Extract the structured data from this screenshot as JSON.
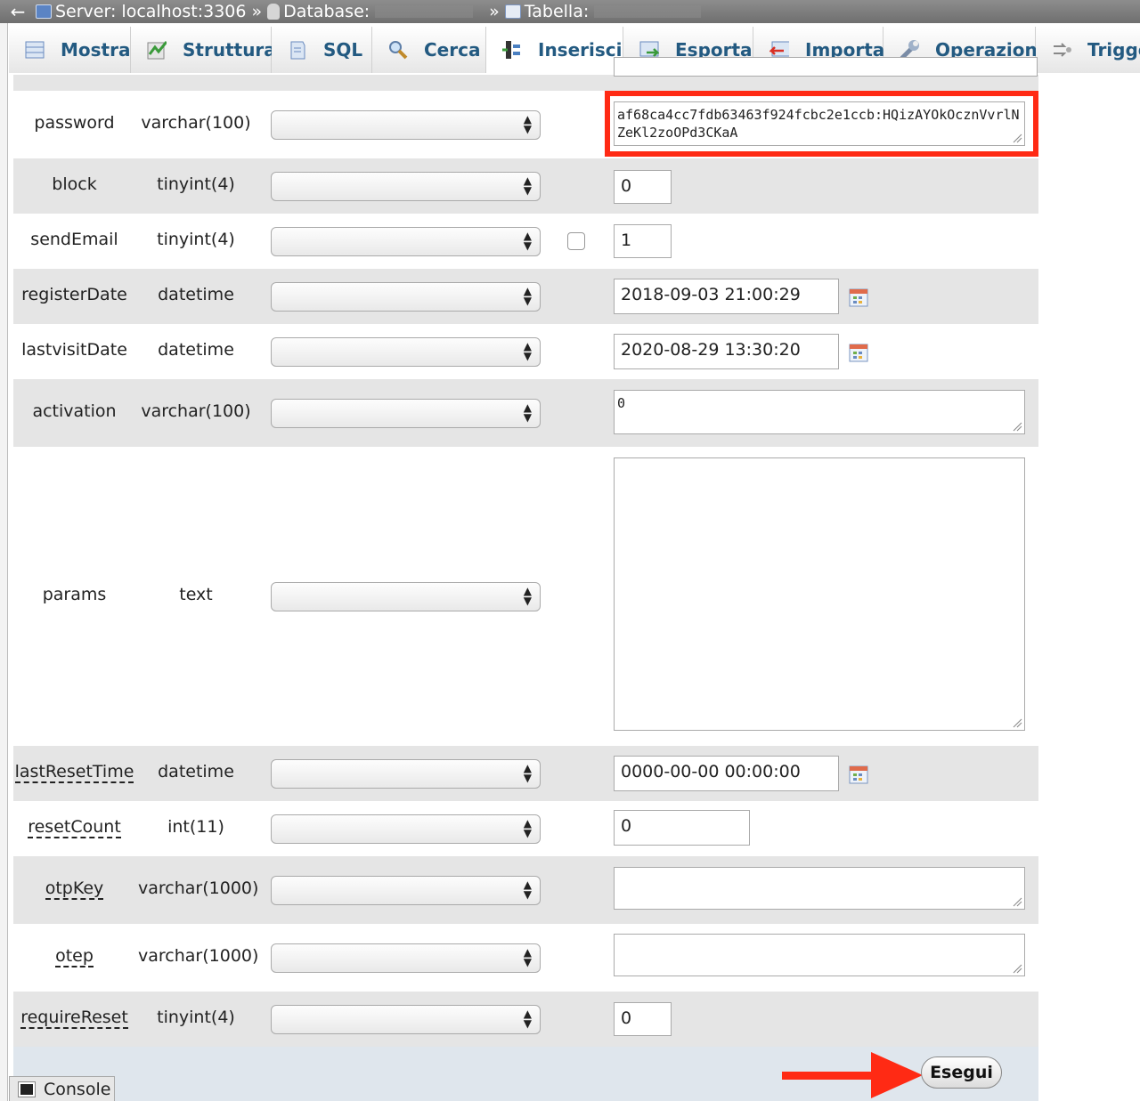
{
  "breadcrumb": {
    "back": "←",
    "server": "Server: localhost:3306",
    "database": "Database:",
    "table": "Tabella:",
    "separator": "»"
  },
  "tabs": [
    {
      "label": "Mostra",
      "icon": "browse-icon"
    },
    {
      "label": "Struttura",
      "icon": "structure-icon"
    },
    {
      "label": "SQL",
      "icon": "sql-icon"
    },
    {
      "label": "Cerca",
      "icon": "search-icon"
    },
    {
      "label": "Inserisci",
      "icon": "insert-icon",
      "active": true
    },
    {
      "label": "Esporta",
      "icon": "export-icon"
    },
    {
      "label": "Importa",
      "icon": "import-icon"
    },
    {
      "label": "Operazioni",
      "icon": "wrench-icon"
    },
    {
      "label": "Trigge",
      "icon": "triggers-icon"
    }
  ],
  "fields": [
    {
      "name": "password",
      "type": "varchar(100)",
      "value": "af68ca4cc7fdb63463f924fcbc2e1ccb:HQizAYOkOcznVvrlNZeKl2zoOPd3CKaA",
      "highlighted": true
    },
    {
      "name": "block",
      "type": "tinyint(4)",
      "value": "0"
    },
    {
      "name": "sendEmail",
      "type": "tinyint(4)",
      "value": "1",
      "null_checkbox": true
    },
    {
      "name": "registerDate",
      "type": "datetime",
      "value": "2018-09-03 21:00:29"
    },
    {
      "name": "lastvisitDate",
      "type": "datetime",
      "value": "2020-08-29 13:30:20"
    },
    {
      "name": "activation",
      "type": "varchar(100)",
      "value": "0"
    },
    {
      "name": "params",
      "type": "text",
      "value": ""
    },
    {
      "name": "lastResetTime",
      "type": "datetime",
      "value": "0000-00-00 00:00:00",
      "has_comment": true
    },
    {
      "name": "resetCount",
      "type": "int(11)",
      "value": "0",
      "has_comment": true
    },
    {
      "name": "otpKey",
      "type": "varchar(1000)",
      "value": "",
      "has_comment": true
    },
    {
      "name": "otep",
      "type": "varchar(1000)",
      "value": "",
      "has_comment": true
    },
    {
      "name": "requireReset",
      "type": "tinyint(4)",
      "value": "0",
      "has_comment": true
    }
  ],
  "submit_label": "Esegui",
  "console_label": "Console",
  "colors": {
    "highlight": "#ff2a14",
    "arrow": "#ff2a14",
    "tab_text": "#235a81"
  }
}
